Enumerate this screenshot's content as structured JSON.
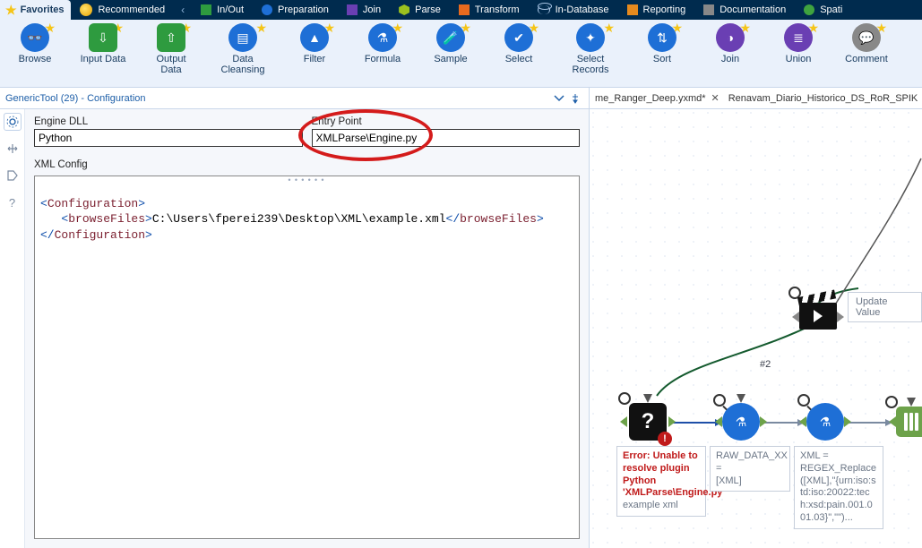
{
  "tabbar": {
    "favorites": "Favorites",
    "items": [
      {
        "label": "Recommended",
        "swatch": "sw-bulb"
      },
      {
        "label": "In/Out",
        "swatch": "sw-green"
      },
      {
        "label": "Preparation",
        "swatch": "sw-blue"
      },
      {
        "label": "Join",
        "swatch": "sw-purple"
      },
      {
        "label": "Parse",
        "swatch": "sw-lime"
      },
      {
        "label": "Transform",
        "swatch": "sw-orange"
      },
      {
        "label": "In-Database",
        "swatch": "sw-db"
      },
      {
        "label": "Reporting",
        "swatch": "sw-report"
      },
      {
        "label": "Documentation",
        "swatch": "sw-doc"
      },
      {
        "label": "Spati",
        "swatch": "sw-spatial"
      }
    ]
  },
  "ribbon": [
    {
      "label": "Browse",
      "glyph": "🔭",
      "color": "#1e6fd6"
    },
    {
      "label": "Input Data",
      "glyph": "📥",
      "color": "#2e9b3f"
    },
    {
      "label": "Output Data",
      "glyph": "📤",
      "color": "#2e9b3f"
    },
    {
      "label": "Data Cleansing",
      "glyph": "🧹",
      "color": "#1e6fd6",
      "wide": true
    },
    {
      "label": "Filter",
      "glyph": "⑂",
      "color": "#1e6fd6"
    },
    {
      "label": "Formula",
      "glyph": "⚗",
      "color": "#1e6fd6"
    },
    {
      "label": "Sample",
      "glyph": "🧪",
      "color": "#1e6fd6"
    },
    {
      "label": "Select",
      "glyph": "✔",
      "color": "#1e6fd6"
    },
    {
      "label": "Select Records",
      "glyph": "✴",
      "color": "#1e6fd6",
      "wide": true
    },
    {
      "label": "Sort",
      "glyph": "⇅",
      "color": "#1e6fd6"
    },
    {
      "label": "Join",
      "glyph": "⋈",
      "color": "#6a3fb3"
    },
    {
      "label": "Union",
      "glyph": "⧉",
      "color": "#6a3fb3"
    },
    {
      "label": "Comment",
      "glyph": "💬",
      "color": "#888"
    }
  ],
  "config": {
    "title": "GenericTool (29) - Configuration",
    "engine_dll_label": "Engine DLL",
    "engine_dll_value": "Python",
    "entry_point_label": "Entry Point",
    "entry_point_value": "XMLParse\\Engine.py",
    "xml_config_label": "XML Config",
    "xml_open_cfg": "<",
    "xml_cfg_name": "Configuration",
    "xml_close": ">",
    "xml_open_bf": "<",
    "xml_bf_name": "browseFiles",
    "xml_text": "C:\\Users\\fperei239\\Desktop\\XML\\example.xml",
    "xml_end_bf": "</",
    "xml_end_cfg": "</"
  },
  "doc_tabs": {
    "t1": "me_Ranger_Deep.yxmd*",
    "t2": "Renavam_Diario_Historico_DS_RoR_SPIK"
  },
  "canvas": {
    "update_value": "Update Value",
    "edge_label_2": "#2",
    "error_text": "Error: Unable to resolve plugin Python 'XMLParse\\Engine.py'",
    "example_caption": "example xml",
    "node2_line1": "RAW_DATA_XX =",
    "node2_line2": "[XML]",
    "node3_line1": "XML =",
    "node3_line2": "REGEX_Replace([XML],\"{urn:iso:std:iso:20022:tech:xsd:pain.001.001.03}\",\"\")..."
  }
}
